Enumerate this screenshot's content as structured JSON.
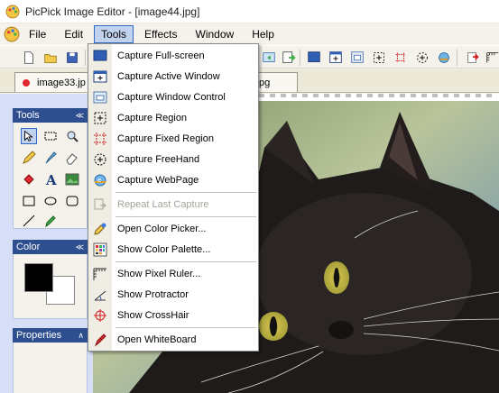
{
  "window": {
    "title": "PicPick Image Editor - [image44.jpg]"
  },
  "menubar": {
    "items": [
      {
        "label": "File"
      },
      {
        "label": "Edit"
      },
      {
        "label": "Tools"
      },
      {
        "label": "Effects"
      },
      {
        "label": "Window"
      },
      {
        "label": "Help"
      }
    ]
  },
  "tabs": [
    {
      "label": "image33.jp"
    },
    {
      "label": "pg"
    }
  ],
  "panels": {
    "tools": "Tools",
    "color": "Color",
    "properties": "Properties"
  },
  "tools_menu": {
    "items": [
      {
        "label": "Capture Full-screen",
        "icon": "monitor-icon"
      },
      {
        "label": "Capture Active Window",
        "icon": "window-icon"
      },
      {
        "label": "Capture Window Control",
        "icon": "window-control-icon"
      },
      {
        "label": "Capture Region",
        "icon": "region-icon"
      },
      {
        "label": "Capture Fixed Region",
        "icon": "fixed-region-icon"
      },
      {
        "label": "Capture FreeHand",
        "icon": "freehand-icon"
      },
      {
        "label": "Capture WebPage",
        "icon": "webpage-icon"
      },
      {
        "label": "Repeat Last Capture",
        "icon": "repeat-icon",
        "disabled": true
      },
      {
        "label": "Open Color Picker...",
        "icon": "color-picker-icon"
      },
      {
        "label": "Show Color Palette...",
        "icon": "palette-icon"
      },
      {
        "label": "Show Pixel Ruler...",
        "icon": "ruler-icon"
      },
      {
        "label": "Show Protractor",
        "icon": "protractor-icon"
      },
      {
        "label": "Show CrossHair",
        "icon": "crosshair-icon"
      },
      {
        "label": "Open WhiteBoard",
        "icon": "whiteboard-icon"
      }
    ]
  },
  "colors": {
    "menu_highlight": "#c1d2ee",
    "menu_highlight_border": "#316ac5",
    "panel_header": "#2d4f8f",
    "primary_color": "#000000",
    "secondary_color": "#ffffff"
  }
}
